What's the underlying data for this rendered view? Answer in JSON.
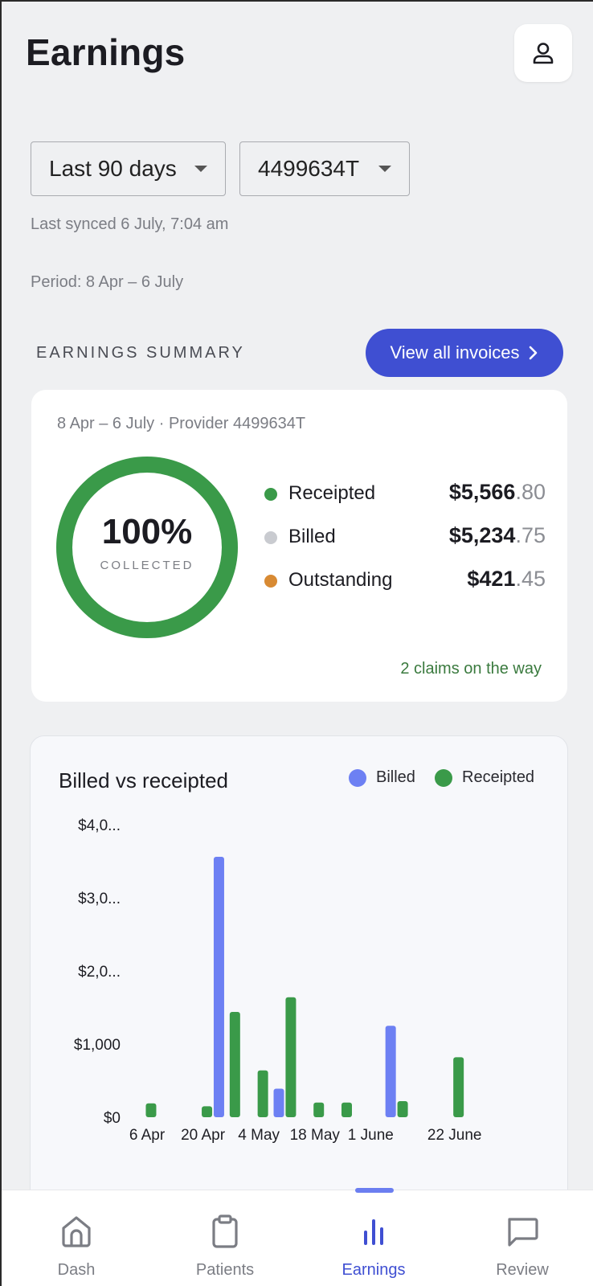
{
  "header": {
    "title": "Earnings"
  },
  "filters": {
    "period_select": "Last 90 days",
    "provider_select": "4499634T",
    "last_synced": "Last synced 6 July, 7:04 am",
    "period": "Period: 8 Apr – 6 July"
  },
  "summary": {
    "section_label": "EARNINGS SUMMARY",
    "view_invoices_label": "View all invoices",
    "card_subtitle": "8 Apr – 6 July · Provider 4499634T",
    "collected_percent_text": "100%",
    "collected_percent_value": 100,
    "collected_label": "COLLECTED",
    "rows": [
      {
        "name": "Receipted",
        "major": "$5,566",
        "minor": ".80",
        "color": "#3a9a49"
      },
      {
        "name": "Billed",
        "major": "$5,234",
        "minor": ".75",
        "color": "#c9cbd0"
      },
      {
        "name": "Outstanding",
        "major": "$421",
        "minor": ".45",
        "color": "#d88a33"
      }
    ],
    "claims_note": "2 claims on the way"
  },
  "chart": {
    "title": "Billed vs receipted",
    "legend": [
      {
        "name": "Billed",
        "color": "#6d80f3"
      },
      {
        "name": "Receipted",
        "color": "#3a9a49"
      }
    ]
  },
  "chart_data": {
    "type": "bar",
    "title": "Billed vs receipted",
    "y_tick_labels": [
      "$0",
      "$1,000",
      "$2,0...",
      "$3,0...",
      "$4,0..."
    ],
    "y_ticks": [
      0,
      1000,
      2000,
      3000,
      4000
    ],
    "ylim": [
      0,
      4000
    ],
    "x_tick_labels": [
      "6 Apr",
      "20 Apr",
      "4 May",
      "18 May",
      "1 June",
      "22 June"
    ],
    "x_tick_days": [
      0,
      14,
      28,
      42,
      56,
      77
    ],
    "series": [
      {
        "name": "Billed",
        "color": "#6d80f3",
        "points": [
          {
            "day": 18,
            "value": 3560
          },
          {
            "day": 33,
            "value": 390
          },
          {
            "day": 61,
            "value": 1250
          }
        ]
      },
      {
        "name": "Receipted",
        "color": "#3a9a49",
        "points": [
          {
            "day": 1,
            "value": 190
          },
          {
            "day": 15,
            "value": 150
          },
          {
            "day": 22,
            "value": 1440
          },
          {
            "day": 29,
            "value": 640
          },
          {
            "day": 36,
            "value": 1640
          },
          {
            "day": 43,
            "value": 200
          },
          {
            "day": 50,
            "value": 200
          },
          {
            "day": 64,
            "value": 220
          },
          {
            "day": 78,
            "value": 820
          }
        ]
      }
    ],
    "grid": false,
    "legend_position": "top-right"
  },
  "tabs": [
    {
      "label": "Dash",
      "icon": "home-icon",
      "active": false
    },
    {
      "label": "Patients",
      "icon": "clipboard-icon",
      "active": false
    },
    {
      "label": "Earnings",
      "icon": "bar-chart-icon",
      "active": true
    },
    {
      "label": "Review",
      "icon": "chat-icon",
      "active": false
    }
  ]
}
